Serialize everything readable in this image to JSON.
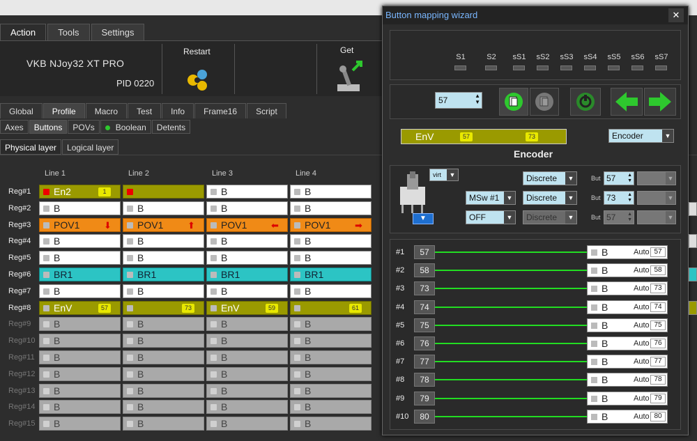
{
  "menu": {
    "tabs": [
      "Action",
      "Tools",
      "Settings"
    ]
  },
  "device": {
    "name": "VKB NJoy32 XT PRO",
    "pid": "PID 0220"
  },
  "toolbar": {
    "restart": "Restart",
    "get": "Get"
  },
  "profile_tabs": [
    "Global",
    "Profile",
    "Macro",
    "Test",
    "Info",
    "Frame16",
    "Script"
  ],
  "sub_tabs": [
    "Axes",
    "Buttons",
    "POVs",
    "Boolean",
    "Detents"
  ],
  "layer_tabs": [
    "Physical layer",
    "Logical layer"
  ],
  "columns": [
    "Line 1",
    "Line 2",
    "Line 3",
    "Line 4"
  ],
  "registers": [
    "Reg#1",
    "Reg#2",
    "Reg#3",
    "Reg#4",
    "Reg#5",
    "Reg#6",
    "Reg#7",
    "Reg#8",
    "Reg#9",
    "Reg#10",
    "Reg#11",
    "Reg#12",
    "Reg#13",
    "Reg#14",
    "Reg#15"
  ],
  "rows": [
    [
      {
        "t": "En2",
        "s": "olive",
        "b": "1",
        "sq": "red"
      },
      {
        "t": "",
        "s": "olive",
        "sq": "red"
      },
      {
        "t": "B",
        "s": "white"
      },
      {
        "t": "B",
        "s": "white"
      }
    ],
    [
      {
        "t": "B",
        "s": "white"
      },
      {
        "t": "B",
        "s": "white"
      },
      {
        "t": "B",
        "s": "white"
      },
      {
        "t": "B",
        "s": "white"
      }
    ],
    [
      {
        "t": "POV1",
        "s": "orange",
        "a": "⬇"
      },
      {
        "t": "POV1",
        "s": "orange",
        "a": "⬆"
      },
      {
        "t": "POV1",
        "s": "orange",
        "a": "⬅"
      },
      {
        "t": "POV1",
        "s": "orange",
        "a": "➡"
      }
    ],
    [
      {
        "t": "B",
        "s": "white"
      },
      {
        "t": "B",
        "s": "white"
      },
      {
        "t": "B",
        "s": "white"
      },
      {
        "t": "B",
        "s": "white"
      }
    ],
    [
      {
        "t": "B",
        "s": "white"
      },
      {
        "t": "B",
        "s": "white"
      },
      {
        "t": "B",
        "s": "white"
      },
      {
        "t": "B",
        "s": "white"
      }
    ],
    [
      {
        "t": "BR1",
        "s": "cyan"
      },
      {
        "t": "BR1",
        "s": "cyan"
      },
      {
        "t": "BR1",
        "s": "cyan"
      },
      {
        "t": "BR1",
        "s": "cyan"
      }
    ],
    [
      {
        "t": "B",
        "s": "white"
      },
      {
        "t": "B",
        "s": "white"
      },
      {
        "t": "B",
        "s": "white"
      },
      {
        "t": "B",
        "s": "white"
      }
    ],
    [
      {
        "t": "EnV",
        "s": "olive",
        "b": "57"
      },
      {
        "t": "",
        "s": "olive",
        "b": "73"
      },
      {
        "t": "EnV",
        "s": "olive",
        "b": "59"
      },
      {
        "t": "",
        "s": "olive",
        "b": "61"
      }
    ],
    [
      {
        "t": "B",
        "s": "grey"
      },
      {
        "t": "B",
        "s": "grey"
      },
      {
        "t": "B",
        "s": "grey"
      },
      {
        "t": "B",
        "s": "grey"
      }
    ],
    [
      {
        "t": "B",
        "s": "grey"
      },
      {
        "t": "B",
        "s": "grey"
      },
      {
        "t": "B",
        "s": "grey"
      },
      {
        "t": "B",
        "s": "grey"
      }
    ],
    [
      {
        "t": "B",
        "s": "grey"
      },
      {
        "t": "B",
        "s": "grey"
      },
      {
        "t": "B",
        "s": "grey"
      },
      {
        "t": "B",
        "s": "grey"
      }
    ],
    [
      {
        "t": "B",
        "s": "grey"
      },
      {
        "t": "B",
        "s": "grey"
      },
      {
        "t": "B",
        "s": "grey"
      },
      {
        "t": "B",
        "s": "grey"
      }
    ],
    [
      {
        "t": "B",
        "s": "grey"
      },
      {
        "t": "B",
        "s": "grey"
      },
      {
        "t": "B",
        "s": "grey"
      },
      {
        "t": "B",
        "s": "grey"
      }
    ],
    [
      {
        "t": "B",
        "s": "grey"
      },
      {
        "t": "B",
        "s": "grey"
      },
      {
        "t": "B",
        "s": "grey"
      },
      {
        "t": "B",
        "s": "grey"
      }
    ],
    [
      {
        "t": "B",
        "s": "grey"
      },
      {
        "t": "B",
        "s": "grey"
      },
      {
        "t": "B",
        "s": "grey"
      },
      {
        "t": "B",
        "s": "grey"
      }
    ]
  ],
  "dialog": {
    "title": "Button mapping wizard",
    "close": "✕",
    "shift_labels": [
      "S1",
      "S2",
      "sS1",
      "sS2",
      "sS3",
      "sS4",
      "sS5",
      "sS6",
      "sS7"
    ],
    "button_number": "57",
    "encoder_bar": {
      "name": "EnV",
      "b1": "57",
      "b2": "73"
    },
    "encoder_type": "Encoder",
    "encoder_label": "Encoder",
    "virt": "virt",
    "mode_rows": [
      {
        "left": "",
        "mode": "Discrete",
        "but": "57",
        "disabled": false
      },
      {
        "left": "MSw #1",
        "mode": "Discrete",
        "but": "73",
        "disabled": false
      },
      {
        "left": "OFF",
        "mode": "Discrete",
        "but": "57",
        "disabled": true
      }
    ],
    "but_label": "But",
    "mapping": [
      {
        "idx": "#1",
        "num": "57",
        "btn": "B",
        "auto": "Auto",
        "val": "57"
      },
      {
        "idx": "#2",
        "num": "58",
        "btn": "B",
        "auto": "Auto",
        "val": "58"
      },
      {
        "idx": "#3",
        "num": "73",
        "btn": "B",
        "auto": "Auto",
        "val": "73"
      },
      {
        "idx": "#4",
        "num": "74",
        "btn": "B",
        "auto": "Auto",
        "val": "74"
      },
      {
        "idx": "#5",
        "num": "75",
        "btn": "B",
        "auto": "Auto",
        "val": "75"
      },
      {
        "idx": "#6",
        "num": "76",
        "btn": "B",
        "auto": "Auto",
        "val": "76"
      },
      {
        "idx": "#7",
        "num": "77",
        "btn": "B",
        "auto": "Auto",
        "val": "77"
      },
      {
        "idx": "#8",
        "num": "78",
        "btn": "B",
        "auto": "Auto",
        "val": "78"
      },
      {
        "idx": "#9",
        "num": "79",
        "btn": "B",
        "auto": "Auto",
        "val": "79"
      },
      {
        "idx": "#10",
        "num": "80",
        "btn": "B",
        "auto": "Auto",
        "val": "80"
      }
    ]
  },
  "colors": {
    "olive": "#9a9a00",
    "orange": "#f08a16",
    "cyan": "#2cc4c4",
    "link_green": "#22dd22",
    "title_blue": "#7ab7ff"
  }
}
